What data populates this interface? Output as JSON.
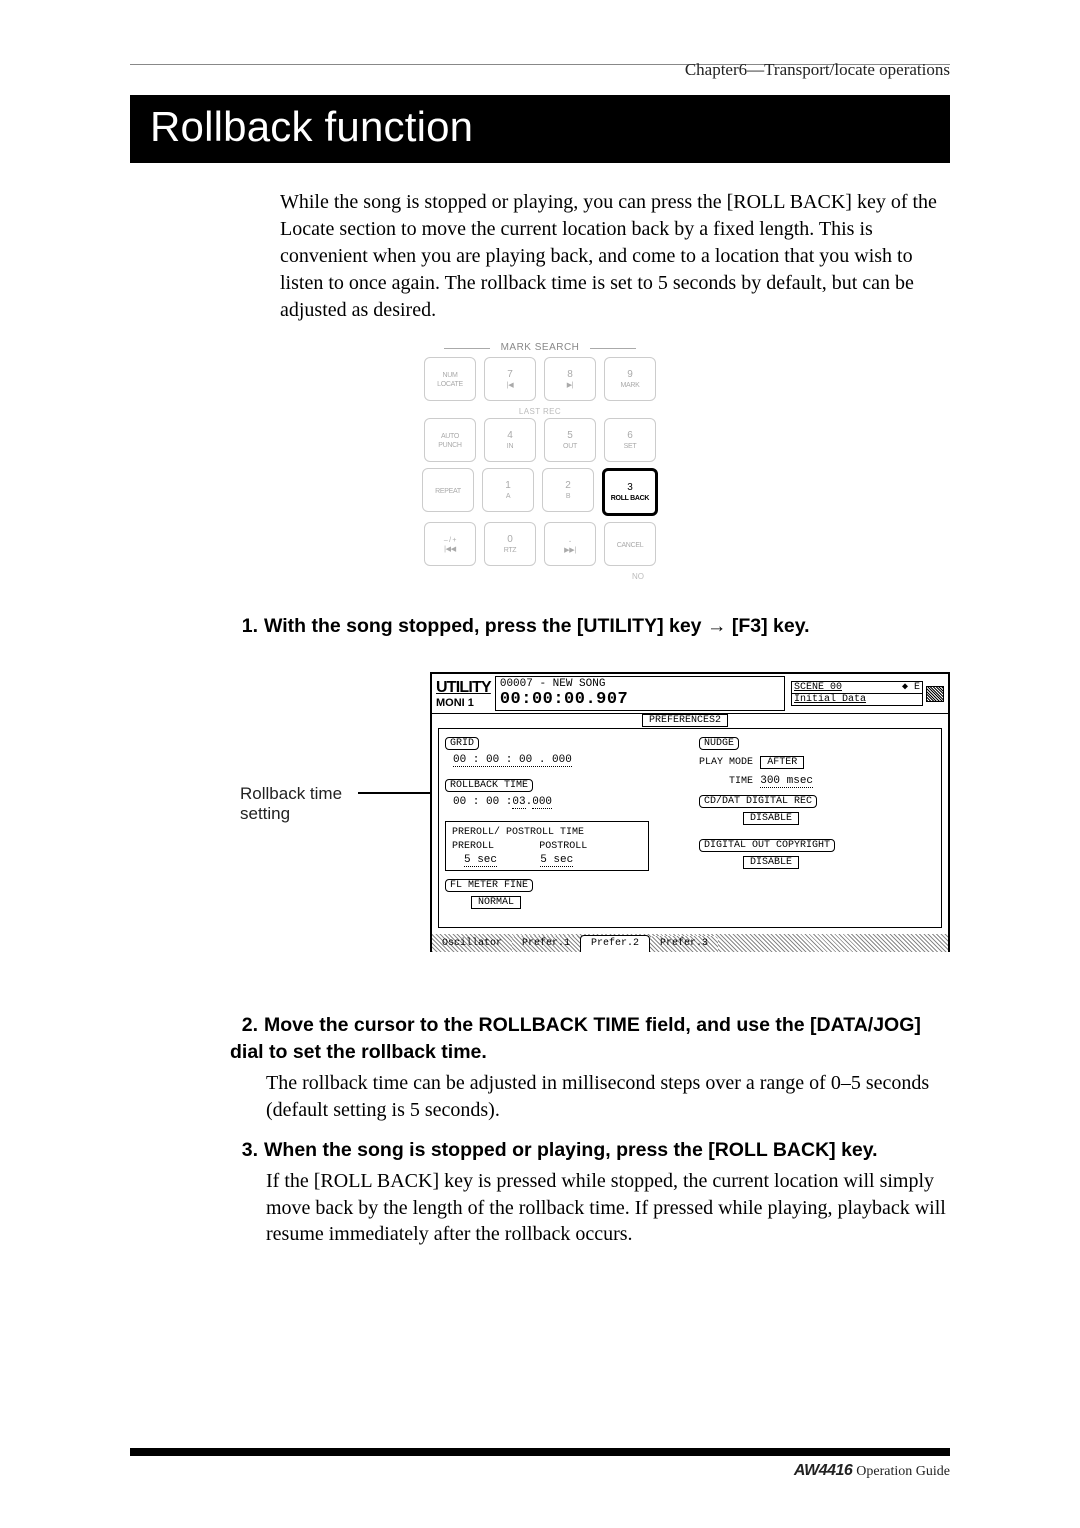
{
  "header": {
    "chapter": "Chapter6—Transport/locate operations"
  },
  "title": "Rollback function",
  "intro": "While the song is stopped or playing, you can press the [ROLL BACK] key of the Locate section to move the current location back by a fixed length. This is convenient when you are playing back, and come to a location that you wish to listen to once again. The rollback time is set to 5 seconds by default, but can be adjusted as desired.",
  "keypad": {
    "mark_search": "MARK SEARCH",
    "last_rec": "LAST REC",
    "no": "NO",
    "rows": [
      [
        {
          "big": "NUM",
          "sub": "LOCATE"
        },
        {
          "num": "7",
          "sub": "|◀"
        },
        {
          "num": "8",
          "sub": "▶|"
        },
        {
          "num": "9",
          "sub": "MARK"
        }
      ],
      [
        {
          "big": "AUTO",
          "sub": "PUNCH"
        },
        {
          "num": "4",
          "sub": "IN"
        },
        {
          "num": "5",
          "sub": "OUT"
        },
        {
          "num": "6",
          "sub": "SET"
        }
      ],
      [
        {
          "big": "REPEAT",
          "sub": ""
        },
        {
          "num": "1",
          "sub": "A"
        },
        {
          "num": "2",
          "sub": "B"
        },
        {
          "num": "3",
          "sub": "ROLL BACK",
          "highlight": true
        }
      ],
      [
        {
          "big": "– / +",
          "sub": "|◀◀"
        },
        {
          "num": "0",
          "sub": "RTZ"
        },
        {
          "num": ".",
          "sub": "▶▶|"
        },
        {
          "big": "CANCEL",
          "sub": ""
        }
      ]
    ]
  },
  "steps": {
    "s1": {
      "num": "1.",
      "head": "With the song stopped, press the [UTILITY] key → [F3] key."
    },
    "s2": {
      "num": "2.",
      "head": "Move the cursor to the ROLLBACK TIME field, and use the [DATA/JOG] dial to set the rollback time.",
      "body": "The rollback time can be adjusted in millisecond steps over a range of 0–5 seconds (default setting is 5 seconds)."
    },
    "s3": {
      "num": "3.",
      "head": "When the song is stopped or playing, press the [ROLL BACK] key.",
      "body": "If the [ROLL BACK] key is pressed while stopped, the current location will simply move back by the length of the rollback time. If pressed while playing, playback will resume immediately after the rollback occurs."
    }
  },
  "callout": {
    "label_l1": "Rollback time",
    "label_l2": "setting"
  },
  "screenshot": {
    "utility": "UTILITY",
    "moni": "MONI 1",
    "song_id": "00007 - NEW SONG",
    "time": "00:00:00.907",
    "scene_num": "SCENE 00",
    "scene_icon": "◆ E",
    "scene_name": "Initial Data",
    "pref2_tab": "PREFERENCES2",
    "grid_lbl": "GRID",
    "grid_val": "00 : 00 : 00 . 000",
    "rollback_lbl": "ROLLBACK TIME",
    "rollback_val": "00 : 00 : 03 . 000",
    "prepost_lbl": "PREROLL/ POSTROLL TIME",
    "preroll_lbl": "PREROLL",
    "postroll_lbl": "POSTROLL",
    "preroll_val": "5 sec",
    "postroll_val": "5 sec",
    "flmeter_lbl": "FL METER FINE",
    "normal_btn": "NORMAL",
    "nudge_lbl": "NUDGE",
    "playmode_lbl": "PLAY MODE",
    "after_btn": "AFTER",
    "time_lbl": "TIME",
    "time_val": "300 msec",
    "cddat_lbl": "CD/DAT DIGITAL REC",
    "disable1": "DISABLE",
    "digout_lbl": "DIGITAL OUT COPYRIGHT",
    "disable2": "DISABLE",
    "tabs": {
      "osc": "Oscillator",
      "p1": "Prefer.1",
      "p2": "Prefer.2",
      "p3": "Prefer.3"
    }
  },
  "footer": {
    "model": "AW4416",
    "guide": "Operation Guide"
  }
}
